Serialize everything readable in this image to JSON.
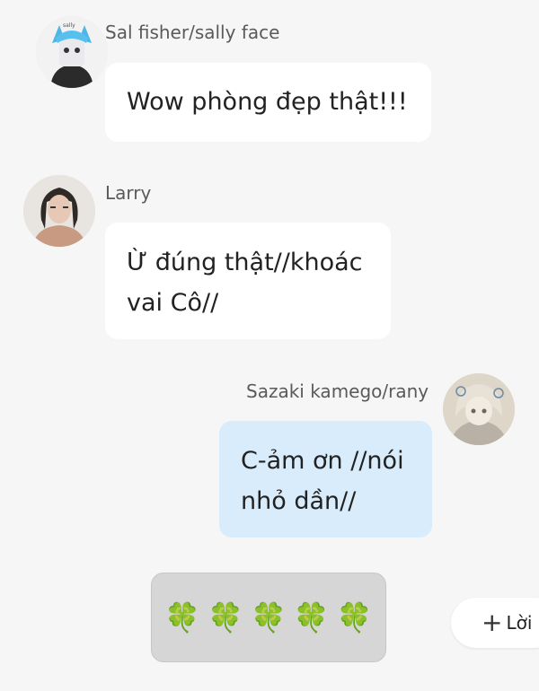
{
  "messages": [
    {
      "author": "Sal fisher/sally face",
      "direction": "incoming",
      "lines": [
        "Wow phòng đẹp thật!!!"
      ]
    },
    {
      "author": "Larry",
      "direction": "incoming",
      "lines": [
        "Ừ đúng thật//khoác",
        "vai Cô//"
      ]
    },
    {
      "author": "Sazaki kamego/rany",
      "direction": "outgoing",
      "lines": [
        "C-ảm ơn //nói",
        "nhỏ dần//"
      ]
    }
  ],
  "sticker": {
    "icon": "four-leaf-clover-icon",
    "glyphs": [
      "🍀",
      "🍀",
      "🍀",
      "🍀",
      "🍀"
    ]
  },
  "reply_button": {
    "icon": "plus-icon",
    "label": "Lời"
  },
  "colors": {
    "background": "#f6f6f6",
    "incoming_bubble": "#ffffff",
    "outgoing_bubble": "#d8ecfb",
    "sticker_bubble": "#d6d6d6"
  }
}
